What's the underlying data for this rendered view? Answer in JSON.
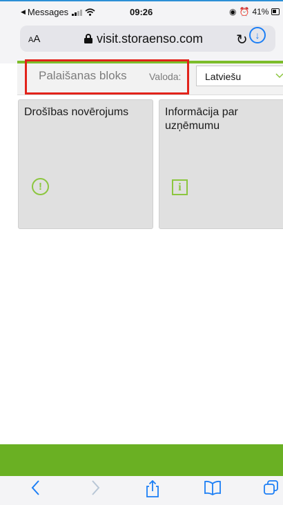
{
  "status_bar": {
    "back_app": "Messages",
    "time": "09:26",
    "battery": "41%"
  },
  "browser": {
    "text_size_button": "AA",
    "url": "visit.storaenso.com"
  },
  "page": {
    "launch_block_title": "Palaišanas bloks",
    "language_label": "Valoda:",
    "language_selected": "Latviešu"
  },
  "tiles": [
    {
      "title": "Drošības novērojums",
      "icon": "exclamation-circle-icon"
    },
    {
      "title": "Informācija par uzņēmumu",
      "icon": "info-square-icon"
    }
  ],
  "colors": {
    "accent_green": "#7cbd2a",
    "bottom_green": "#6ab023",
    "ios_blue": "#1b7ef5",
    "highlight_red": "#e2231a"
  }
}
